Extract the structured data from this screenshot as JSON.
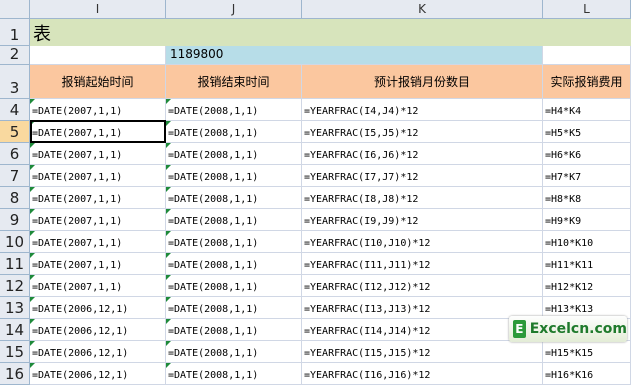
{
  "columns": [
    "I",
    "J",
    "K",
    "L"
  ],
  "rows": [
    "1",
    "2",
    "3",
    "4",
    "5",
    "6",
    "7",
    "8",
    "9",
    "10",
    "11",
    "12",
    "13",
    "14",
    "15",
    "16"
  ],
  "selected_row": "5",
  "title": "表",
  "total_value": "1189800",
  "headers": [
    "报销起始时间",
    "报销结束时间",
    "预计报销月份数目",
    "实际报销费用"
  ],
  "data_rows": [
    [
      "=DATE(2007,1,1)",
      "=DATE(2008,1,1)",
      "=YEARFRAC(I4,J4)*12",
      "=H4*K4"
    ],
    [
      "=DATE(2007,1,1)",
      "=DATE(2008,1,1)",
      "=YEARFRAC(I5,J5)*12",
      "=H5*K5"
    ],
    [
      "=DATE(2007,1,1)",
      "=DATE(2008,1,1)",
      "=YEARFRAC(I6,J6)*12",
      "=H6*K6"
    ],
    [
      "=DATE(2007,1,1)",
      "=DATE(2008,1,1)",
      "=YEARFRAC(I7,J7)*12",
      "=H7*K7"
    ],
    [
      "=DATE(2007,1,1)",
      "=DATE(2008,1,1)",
      "=YEARFRAC(I8,J8)*12",
      "=H8*K8"
    ],
    [
      "=DATE(2007,1,1)",
      "=DATE(2008,1,1)",
      "=YEARFRAC(I9,J9)*12",
      "=H9*K9"
    ],
    [
      "=DATE(2007,1,1)",
      "=DATE(2008,1,1)",
      "=YEARFRAC(I10,J10)*12",
      "=H10*K10"
    ],
    [
      "=DATE(2007,1,1)",
      "=DATE(2008,1,1)",
      "=YEARFRAC(I11,J11)*12",
      "=H11*K11"
    ],
    [
      "=DATE(2007,1,1)",
      "=DATE(2008,1,1)",
      "=YEARFRAC(I12,J12)*12",
      "=H12*K12"
    ],
    [
      "=DATE(2006,12,1)",
      "=DATE(2008,1,1)",
      "=YEARFRAC(I13,J13)*12",
      "=H13*K13"
    ],
    [
      "=DATE(2006,12,1)",
      "=DATE(2008,1,1)",
      "=YEARFRAC(I14,J14)*12",
      "=H14*K14"
    ],
    [
      "=DATE(2006,12,1)",
      "=DATE(2008,1,1)",
      "=YEARFRAC(I15,J15)*12",
      "=H15*K15"
    ],
    [
      "=DATE(2006,12,1)",
      "=DATE(2008,1,1)",
      "=YEARFRAC(I16,J16)*12",
      "=H16*K16"
    ]
  ],
  "watermark": "Excelcn.com",
  "colors": {
    "title_fill": "#d7e4bc",
    "header_fill": "#fbc79f",
    "total_fill": "#b7dde8",
    "selected_header": "#f9d99f"
  }
}
